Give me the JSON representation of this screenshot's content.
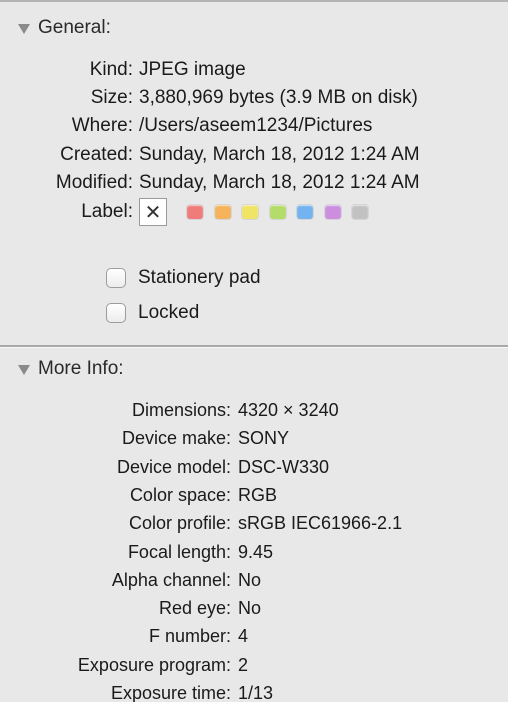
{
  "general": {
    "header": "General:",
    "rows": [
      {
        "label": "Kind:",
        "value": "JPEG image"
      },
      {
        "label": "Size:",
        "value": "3,880,969 bytes (3.9 MB on disk)"
      },
      {
        "label": "Where:",
        "value": "/Users/aseem1234/Pictures"
      },
      {
        "label": "Created:",
        "value": "Sunday, March 18, 2012 1:24 AM"
      },
      {
        "label": "Modified:",
        "value": "Sunday, March 18, 2012 1:24 AM"
      }
    ],
    "label_row": {
      "label": "Label:",
      "none_glyph": "✕",
      "colors": [
        {
          "name": "red",
          "hex": "#f07b7b"
        },
        {
          "name": "orange",
          "hex": "#f5b35c"
        },
        {
          "name": "yellow",
          "hex": "#f0e466"
        },
        {
          "name": "green",
          "hex": "#b4dc6a"
        },
        {
          "name": "blue",
          "hex": "#72b3f0"
        },
        {
          "name": "purple",
          "hex": "#cc8fe0"
        },
        {
          "name": "gray",
          "hex": "#c2c2c2"
        }
      ]
    },
    "checkboxes": [
      {
        "label": "Stationery pad",
        "checked": false
      },
      {
        "label": "Locked",
        "checked": false
      }
    ]
  },
  "more_info": {
    "header": "More Info:",
    "rows": [
      {
        "label": "Dimensions:",
        "value": "4320 × 3240"
      },
      {
        "label": "Device make:",
        "value": "SONY"
      },
      {
        "label": "Device model:",
        "value": "DSC-W330"
      },
      {
        "label": "Color space:",
        "value": "RGB"
      },
      {
        "label": "Color profile:",
        "value": "sRGB IEC61966-2.1"
      },
      {
        "label": "Focal length:",
        "value": "9.45"
      },
      {
        "label": "Alpha channel:",
        "value": "No"
      },
      {
        "label": "Red eye:",
        "value": "No"
      },
      {
        "label": "F number:",
        "value": "4"
      },
      {
        "label": "Exposure program:",
        "value": "2"
      },
      {
        "label": "Exposure time:",
        "value": "1/13"
      }
    ]
  }
}
